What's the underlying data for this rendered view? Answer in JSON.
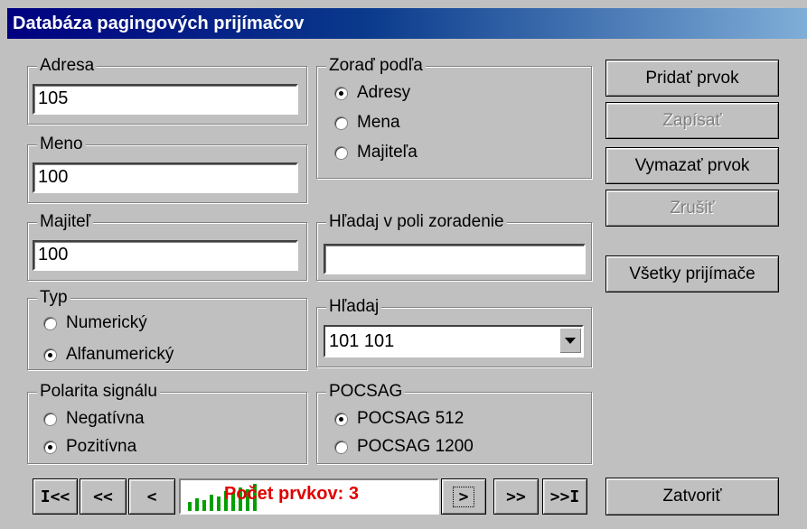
{
  "window": {
    "title": "Databáza pagingových prijímačov"
  },
  "adresa": {
    "label": "Adresa",
    "value": "105"
  },
  "meno": {
    "label": "Meno",
    "value": "100"
  },
  "majitel": {
    "label": "Majiteľ",
    "value": "100"
  },
  "zoradit": {
    "label": "Zoraď podľa",
    "options": [
      {
        "label": "Adresy",
        "checked": true
      },
      {
        "label": "Mena",
        "checked": false
      },
      {
        "label": "Majiteľa",
        "checked": false
      }
    ]
  },
  "hladaj_pole": {
    "label": "Hľadaj v poli zoradenie",
    "value": ""
  },
  "hladaj": {
    "label": "Hľadaj",
    "selected": "101  101"
  },
  "typ": {
    "label": "Typ",
    "options": [
      {
        "label": "Numerický",
        "checked": false
      },
      {
        "label": "Alfanumerický",
        "checked": true
      }
    ]
  },
  "polarita": {
    "label": "Polarita signálu",
    "options": [
      {
        "label": "Negatívna",
        "checked": false
      },
      {
        "label": "Pozitívna",
        "checked": true
      }
    ]
  },
  "pocsag": {
    "label": "POCSAG",
    "options": [
      {
        "label": "POCSAG 512",
        "checked": true
      },
      {
        "label": "POCSAG 1200",
        "checked": false
      }
    ]
  },
  "buttons": {
    "pridat": "Pridať prvok",
    "zapisat": "Zapísať",
    "vymazat": "Vymazať prvok",
    "zrusit": "Zrušiť",
    "vsetky": "Všetky prijímače",
    "zatvorit": "Zatvoriť"
  },
  "nav": {
    "first": "I<<",
    "prev_page": "<<",
    "prev": "<",
    "next": ">",
    "next_page": ">>",
    "last": ">>I"
  },
  "status": {
    "text": "Počet prvkov: 3",
    "bar_color": "#00a000",
    "text_color": "#e00000"
  }
}
